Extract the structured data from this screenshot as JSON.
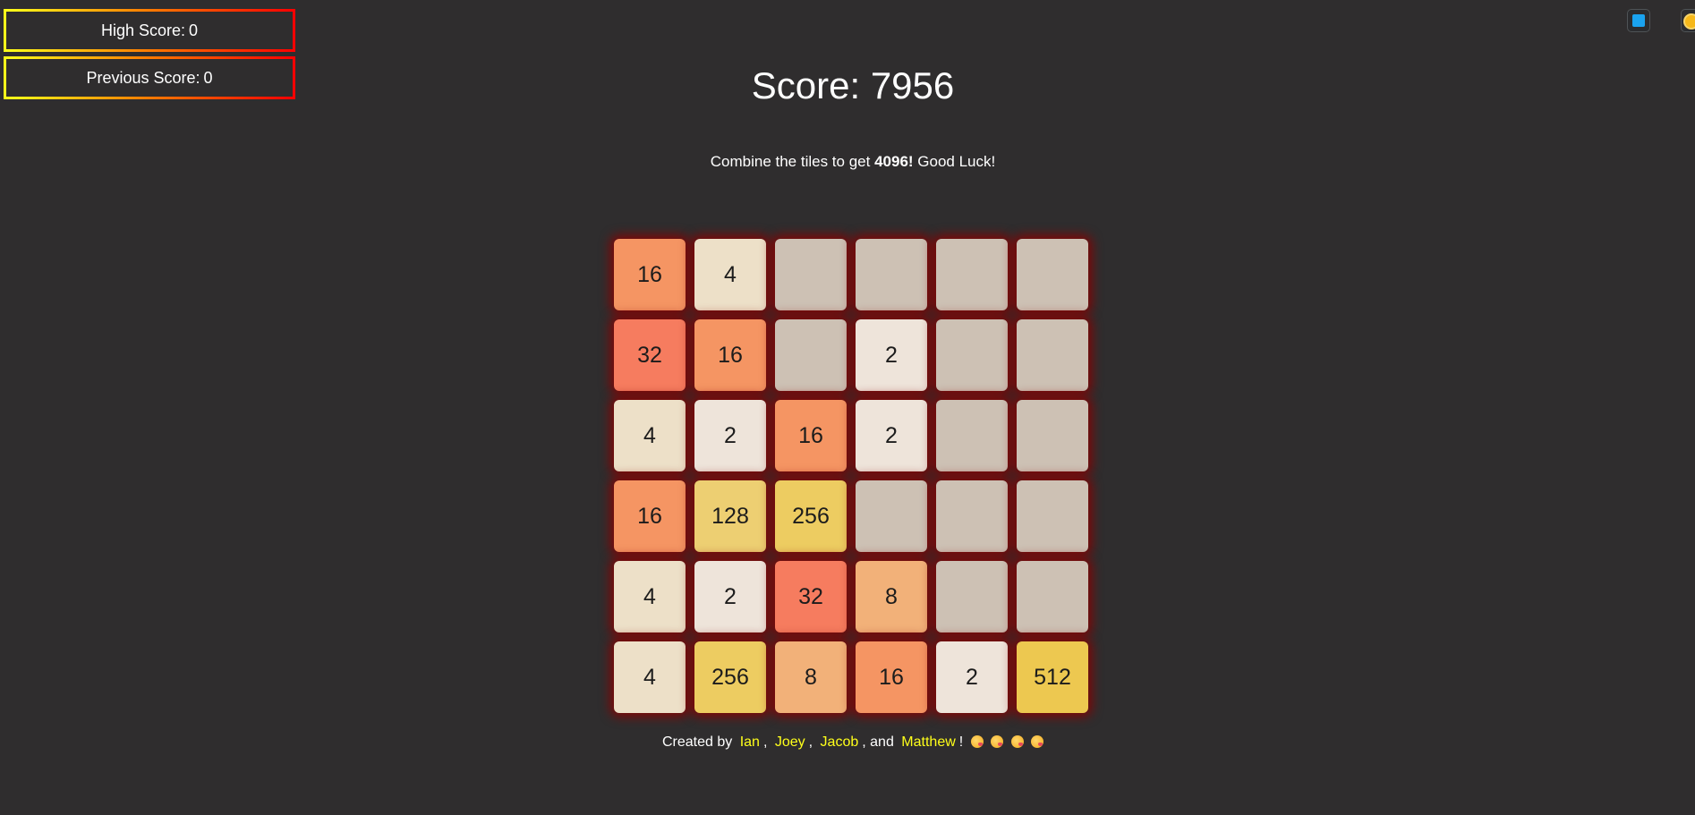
{
  "scores": {
    "high_label": "High Score:",
    "high_value": "0",
    "previous_label": "Previous Score:",
    "previous_value": "0"
  },
  "header": {
    "score_label": "Score:",
    "score_value": "7956",
    "subtitle_prefix": "Combine the tiles to get",
    "subtitle_target": "4096!",
    "subtitle_suffix": "Good Luck!"
  },
  "board": {
    "rows": [
      [
        "16",
        "4",
        "",
        "",
        "",
        ""
      ],
      [
        "32",
        "16",
        "",
        "2",
        "",
        ""
      ],
      [
        "4",
        "2",
        "16",
        "2",
        "",
        ""
      ],
      [
        "16",
        "128",
        "256",
        "",
        "",
        ""
      ],
      [
        "4",
        "2",
        "32",
        "8",
        "",
        ""
      ],
      [
        "4",
        "256",
        "8",
        "16",
        "2",
        "512"
      ]
    ],
    "tile_colors": {
      "": "#cdc1b4",
      "2": "#eee4da",
      "4": "#ede0c8",
      "8": "#f2b179",
      "16": "#f59563",
      "32": "#f67c5f",
      "128": "#edcf72",
      "256": "#edcc61",
      "512": "#edc850"
    }
  },
  "footer": {
    "created_by": "Created by",
    "names": [
      "Ian",
      "Joey",
      "Jacob",
      "Matthew"
    ],
    "sep1": ",",
    "sep2": ",",
    "sep3": ", and",
    "end": "!",
    "emoji_icons": [
      "kissing-face-icon",
      "kissing-face-icon",
      "kissing-face-icon",
      "kissing-face-icon"
    ]
  },
  "toolbar_icons": [
    "blue-square-icon",
    "sun-icon"
  ]
}
